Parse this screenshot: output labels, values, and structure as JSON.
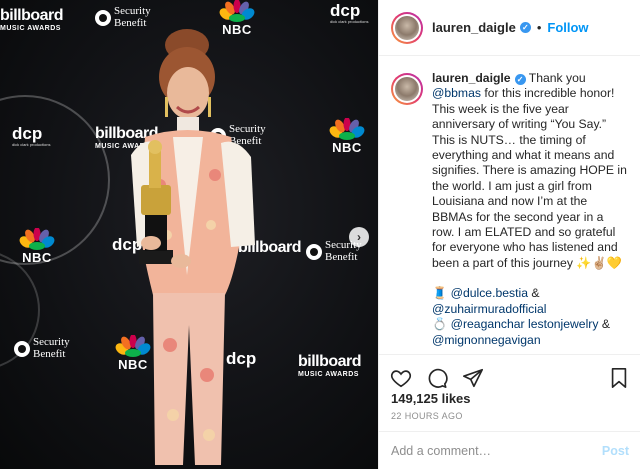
{
  "photo": {
    "logos": {
      "billboard": "billboard",
      "billboard_sub": "MUSIC AWARDS",
      "dcp": "dcp",
      "dcp_sub": "dick clark productions",
      "security_line1": "Security",
      "security_line2": "Benefit",
      "nbc": "NBC"
    },
    "next_icon": "chevron-right-icon"
  },
  "header": {
    "username": "lauren_daigle",
    "separator": "•",
    "follow_label": "Follow",
    "verified_icon": "verified-badge-icon"
  },
  "caption": {
    "username": "lauren_daigle",
    "text_before_mention": " Thank you ",
    "mention1": "@bbmas",
    "text_main": " for this incredible honor! This week is the five year anniversary of writing “You Say.” This is NUTS… the timing of everything and what it means and signifies. There is amazing HOPE in the world. I am just a girl from Louisiana and now I’m at the BBMAs for the second year in a row. I am ELATED and so grateful for everyone who has listened and been a part of this journey ✨✌🏼💛",
    "credit1_emoji": "🧵",
    "credit1_mention": "@dulce.bestia",
    "credit1_suffix": " &",
    "credit2_mention": "@zuhairmuradofficial",
    "credit3_emoji": "💍",
    "credit3_mention": "@reaganchar lestonjewelry",
    "credit3_suffix": " &",
    "credit4_mention": "@mignonnegavigan",
    "time": "22h"
  },
  "actions": {
    "like_icon": "heart-icon",
    "comment_icon": "comment-icon",
    "share_icon": "paper-plane-icon",
    "save_icon": "bookmark-icon"
  },
  "likes": "149,125 likes",
  "posted_ago": "22 HOURS AGO",
  "add_comment": {
    "placeholder": "Add a comment…",
    "post_label": "Post"
  },
  "colors": {
    "accent": "#0095f6",
    "verified": "#3897f0",
    "mention": "#00376b",
    "post_disabled": "#b2dffc",
    "muted": "#8e8e8e"
  }
}
